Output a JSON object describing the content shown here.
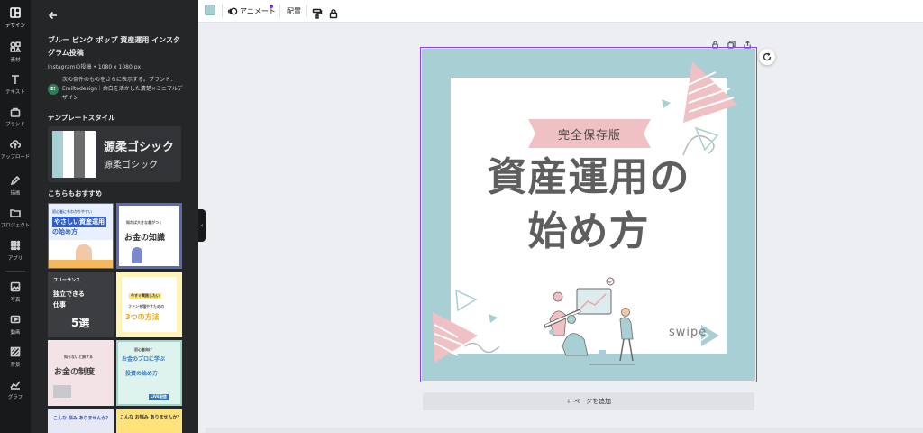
{
  "rail": {
    "items": [
      {
        "label": "デザイン",
        "icon": "layout-icon"
      },
      {
        "label": "素材",
        "icon": "elements-icon"
      },
      {
        "label": "テキスト",
        "icon": "text-icon"
      },
      {
        "label": "ブランド",
        "icon": "brand-icon"
      },
      {
        "label": "アップロード",
        "icon": "upload-icon"
      },
      {
        "label": "描画",
        "icon": "draw-icon"
      },
      {
        "label": "プロジェクト",
        "icon": "folder-icon"
      },
      {
        "label": "アプリ",
        "icon": "apps-icon"
      },
      {
        "label": "写真",
        "icon": "photo-icon"
      },
      {
        "label": "動画",
        "icon": "video-icon"
      },
      {
        "label": "背景",
        "icon": "background-icon"
      },
      {
        "label": "グラフ",
        "icon": "chart-icon"
      }
    ]
  },
  "panel": {
    "template_title": "ブルー ピンク ポップ 資産運用 インスタグラム投稿",
    "template_size": "Instagramの投稿 • 1080 x 1080 px",
    "brand_avatar": "E!",
    "brand_text": "次の条件のものをさらに表示する。ブランド：Emiltodesign｜余白を活かした清楚×ミニマルデザイン",
    "style_heading": "テンプレートスタイル",
    "style_font_primary": "源柔ゴシック",
    "style_font_secondary": "源柔ゴシック",
    "recommended_heading": "こちらもおすすめ",
    "thumbs": {
      "t1": {
        "small": "初心者にもわかりやすい",
        "title1": "やさしい資産運用",
        "title2": "の始め方"
      },
      "t2": {
        "small": "知れば大きな差がつく",
        "title": "お金の知識"
      },
      "t3": {
        "small": "フリーランス",
        "title1": "独立できる",
        "title2": "仕事",
        "num": "5選"
      },
      "t4": {
        "small": "今すぐ実践したい",
        "mid": "ファンを増やすための",
        "title": "3つの方法"
      },
      "t5": {
        "small": "知らないと損する",
        "title": "お金の制度"
      },
      "t6": {
        "small": "初心者向け",
        "title1": "お金のプロに学ぶ",
        "title2": "投資の始め方",
        "tag": "LIVE配信"
      },
      "t7": {
        "title": "こんな 悩み ありませんか？"
      },
      "t8": {
        "title": "こんな お悩み ありませんか？"
      }
    }
  },
  "toolbar": {
    "swatch_color": "#a8cfd3",
    "animate_label": "アニメート",
    "arrange_label": "配置"
  },
  "canvas": {
    "badge": "完全保存版",
    "headline_line1": "資産運用の",
    "headline_line2": "始め方",
    "swipe": "swipe",
    "add_page": "+ ページを追加",
    "colors": {
      "teal": "#a8cfd3",
      "pink": "#efc1c4",
      "text": "#5e5e5e"
    }
  }
}
